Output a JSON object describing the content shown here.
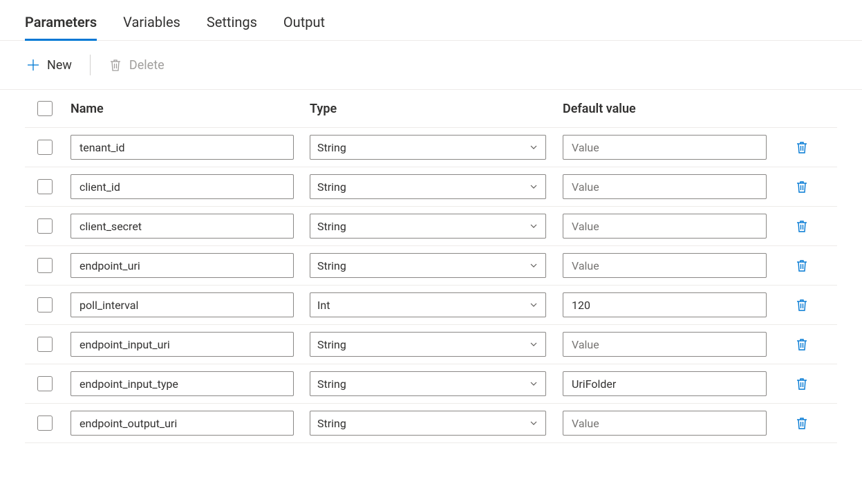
{
  "tabs": [
    {
      "label": "Parameters",
      "active": true
    },
    {
      "label": "Variables",
      "active": false
    },
    {
      "label": "Settings",
      "active": false
    },
    {
      "label": "Output",
      "active": false
    }
  ],
  "toolbar": {
    "new_label": "New",
    "delete_label": "Delete"
  },
  "columns": {
    "name": "Name",
    "type": "Type",
    "default": "Default value"
  },
  "default_placeholder": "Value",
  "rows": [
    {
      "name": "tenant_id",
      "type": "String",
      "default": ""
    },
    {
      "name": "client_id",
      "type": "String",
      "default": ""
    },
    {
      "name": "client_secret",
      "type": "String",
      "default": ""
    },
    {
      "name": "endpoint_uri",
      "type": "String",
      "default": ""
    },
    {
      "name": "poll_interval",
      "type": "Int",
      "default": "120"
    },
    {
      "name": "endpoint_input_uri",
      "type": "String",
      "default": ""
    },
    {
      "name": "endpoint_input_type",
      "type": "String",
      "default": "UriFolder"
    },
    {
      "name": "endpoint_output_uri",
      "type": "String",
      "default": ""
    }
  ]
}
